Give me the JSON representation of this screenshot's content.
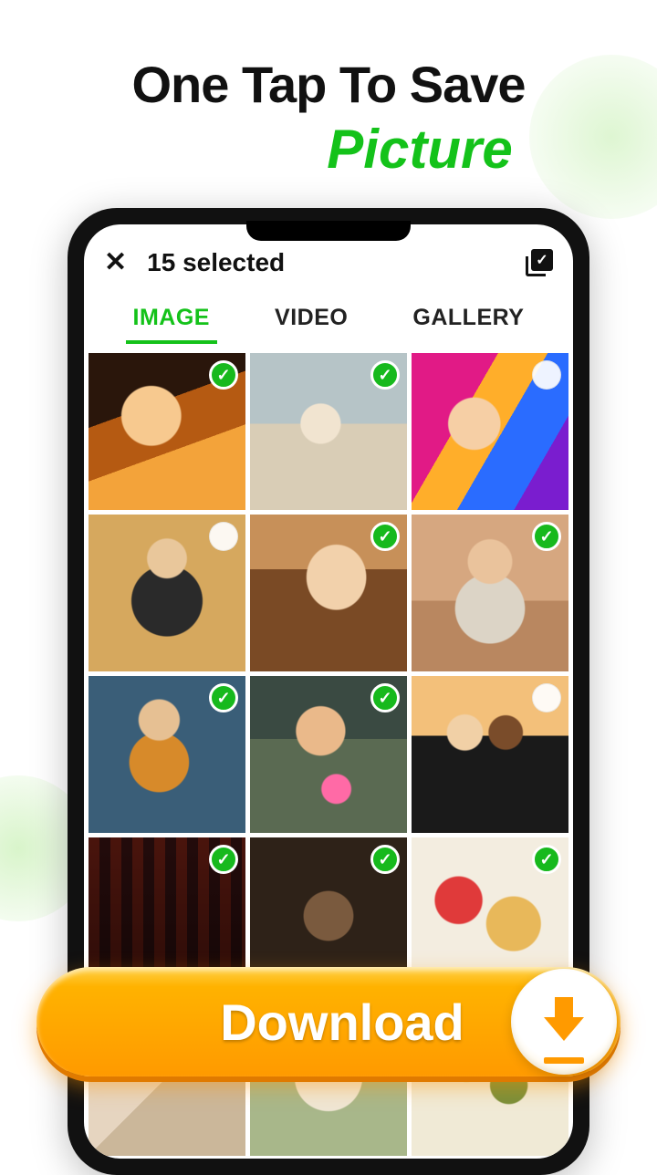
{
  "headline": {
    "line1": "One Tap To Save",
    "line2": "Picture"
  },
  "header": {
    "close_icon": "✕",
    "selected_text": "15 selected",
    "select_all_check": "✓"
  },
  "tabs": [
    {
      "label": "IMAGE",
      "active": true
    },
    {
      "label": "VIDEO",
      "active": false
    },
    {
      "label": "GALLERY",
      "active": false
    }
  ],
  "grid": [
    {
      "thumb": "th1",
      "selected": true
    },
    {
      "thumb": "th2",
      "selected": true
    },
    {
      "thumb": "th3",
      "selected": false
    },
    {
      "thumb": "th4",
      "selected": false
    },
    {
      "thumb": "th5",
      "selected": true
    },
    {
      "thumb": "th6",
      "selected": true
    },
    {
      "thumb": "th7",
      "selected": true
    },
    {
      "thumb": "th8",
      "selected": true
    },
    {
      "thumb": "th9",
      "selected": false
    },
    {
      "thumb": "th10",
      "selected": true
    },
    {
      "thumb": "th11",
      "selected": true
    },
    {
      "thumb": "th12",
      "selected": true
    },
    {
      "thumb": "th13",
      "selected": true
    },
    {
      "thumb": "th14",
      "selected": true
    },
    {
      "thumb": "th15",
      "selected": true
    }
  ],
  "download": {
    "label": "Download",
    "icon": "download-icon"
  },
  "colors": {
    "accent_green": "#14c21a",
    "accent_orange": "#ff9a00"
  }
}
